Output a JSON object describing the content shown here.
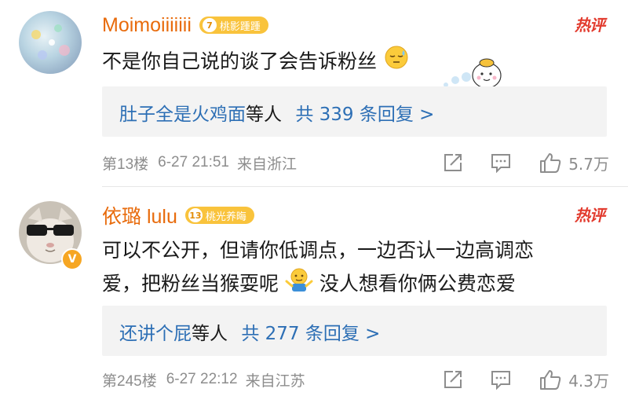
{
  "comments": [
    {
      "username": "Moimoiiiiiii",
      "fan_level": "7",
      "fan_badge": "桃影踵踵",
      "hot_label": "热评",
      "text": "不是你自己说的谈了会告诉粉丝",
      "reply_user": "肚子全是火鸡面",
      "reply_suffix": "等人",
      "reply_count": "共 339 条回复 >",
      "floor": "第13楼",
      "datetime": "6-27 21:51",
      "location": "来自浙江",
      "likes": "5.7万"
    },
    {
      "username": "依璐 lulu",
      "fan_level": "13",
      "fan_badge": "桃光养晦",
      "verified": "V",
      "hot_label": "热评",
      "text_line1": "可以不公开，但请你低调点，一边否认一边高调恋",
      "text_line2a": "爱，把粉丝当猴耍呢",
      "text_line2b": "没人想看你俩公费恋爱",
      "reply_user": "还讲个屁",
      "reply_suffix": "等人",
      "reply_count": "共 277 条回复 >",
      "floor": "第245楼",
      "datetime": "6-27 22:12",
      "location": "来自江苏",
      "likes": "4.3万"
    }
  ],
  "icons": [
    "share-icon",
    "comment-icon",
    "like-icon",
    "sleepy-emoji-icon",
    "shrug-emoji-icon",
    "sticker-icon"
  ],
  "colors": {
    "username": "#e86b0c",
    "link": "#2d6fb5",
    "hot": "#e23b2e",
    "badge": "#f9c33c",
    "meta": "#8d8d8d"
  }
}
